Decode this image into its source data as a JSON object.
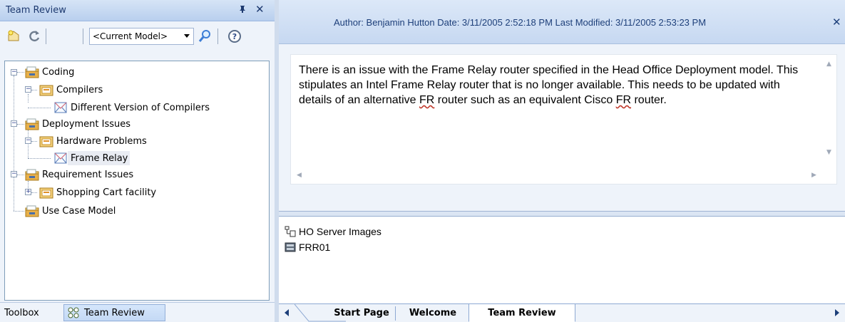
{
  "left_panel": {
    "title": "Team Review",
    "pin_glyph": "⸏",
    "close_glyph": "✕",
    "model_select": {
      "value": "<Current Model>"
    },
    "tree": [
      {
        "label": "Coding",
        "expander": "−",
        "icon": "folder-category-icon"
      },
      {
        "label": "Compilers",
        "expander": "−",
        "icon": "folder-topic-icon"
      },
      {
        "label": "Different Version of Compilers",
        "icon": "post-document-icon"
      },
      {
        "label": "Deployment Issues",
        "expander": "−",
        "icon": "folder-category-icon"
      },
      {
        "label": "Hardware Problems",
        "expander": "−",
        "icon": "folder-topic-icon"
      },
      {
        "label": "Frame Relay",
        "icon": "post-document-icon",
        "selected": true
      },
      {
        "label": "Requirement Issues",
        "expander": "−",
        "icon": "folder-category-icon"
      },
      {
        "label": "Shopping Cart facility",
        "expander": "+",
        "icon": "folder-topic-icon"
      },
      {
        "label": "Use Case Model",
        "icon": "folder-category-icon"
      }
    ],
    "tabs": [
      {
        "label": "Toolbox"
      },
      {
        "label": "Team Review",
        "active": true
      }
    ]
  },
  "right_panel": {
    "header": {
      "meta": "Author: Benjamin Hutton   Date: 3/11/2005 2:52:18 PM   Last Modified: 3/11/2005 2:53:23 PM",
      "close_glyph": "✕"
    },
    "note": {
      "part1": "There is an issue with the Frame Relay router specified in the Head Office Deployment model.  This stipulates an Intel Frame Relay router that is no longer available.  This needs to be updated with details of an alternative ",
      "abbr1": "FR",
      "part2": " router such as an equivalent Cisco ",
      "abbr2": "FR",
      "part3": " router."
    },
    "links": [
      {
        "label": "HO Server Images",
        "icon": "diagram-icon"
      },
      {
        "label": "FRR01",
        "icon": "node-icon"
      }
    ],
    "tabs": [
      {
        "label": "Start Page"
      },
      {
        "label": "Welcome"
      },
      {
        "label": "Team Review",
        "active": true
      }
    ]
  },
  "colors": {
    "title_gradient_top": "#d6e4f6",
    "title_gradient_bottom": "#b9cfee",
    "folder_tan": "#f0c86a",
    "folder_dark": "#c8932a",
    "panel_bg": "#eef3fa"
  }
}
